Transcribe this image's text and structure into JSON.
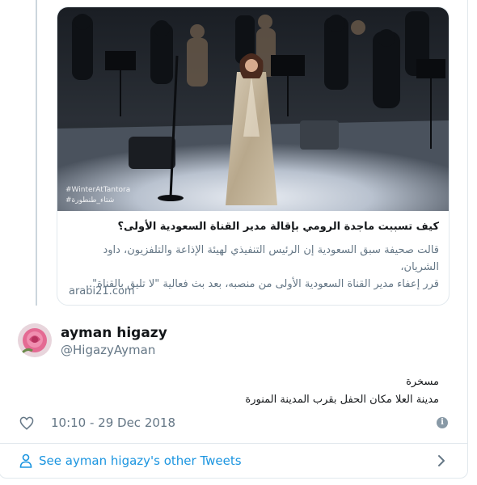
{
  "link_card": {
    "image_caption": "#WinterAtTantora",
    "image_caption_ar": "#شتاء_طنطورة",
    "title": "كيف تسببت ماجدة الرومي بإقالة مدير القناة السعودية الأولى؟",
    "description_line1": "قالت صحيفة سبق السعودية إن الرئيس التنفيذي لهيئة الإذاعة والتلفزيون، داود الشريان،",
    "description_line2": "قرر إعفاء مدير القناة السعودية الأولى من منصبه، بعد بث فعالية \"لا تليق بالقناة\"..",
    "domain": "arabi21.com"
  },
  "tweet": {
    "display_name": "ayman higazy",
    "handle": "@HigazyAyman",
    "text_line1": "مسخرة",
    "text_line2": "مدينة العلا مكان الحفل بقرب المدينة المنورة",
    "timestamp": "10:10 - 29 Dec 2018"
  },
  "footer": {
    "other_tweets_label": "See ayman higazy's other Tweets"
  },
  "colors": {
    "link_blue": "#1b95e0",
    "muted_gray": "#657786",
    "border": "#e1e8ed"
  },
  "icons": {
    "like": "heart-icon",
    "info": "info-icon",
    "user": "user-icon",
    "chevron": "chevron-right-icon"
  }
}
